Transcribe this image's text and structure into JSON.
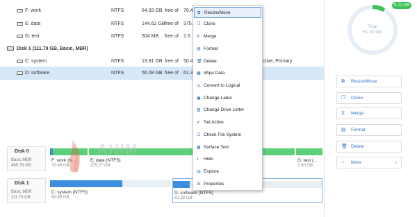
{
  "partitions_top": [
    {
      "name": "F: work",
      "fs": "NTFS",
      "capacity": "64.93 GB",
      "free_label": "free of",
      "free": "70.4"
    },
    {
      "name": "E: data",
      "fs": "NTFS",
      "capacity": "144.62 GB",
      "free_label": "free of",
      "free": "375.2"
    },
    {
      "name": "G: test",
      "fs": "NTFS",
      "capacity": "304 MB",
      "free_label": "free of",
      "free": "1.5"
    }
  ],
  "disk1_header": "Disk 1 (111.79 GB, Basic, MBR)",
  "partitions_disk1": [
    {
      "name": "C: system",
      "fs": "NTFS",
      "capacity": "19.81 GB",
      "free_label": "free of",
      "free": "50.4",
      "type": "ctive, Primary"
    },
    {
      "name": "D: software",
      "fs": "NTFS",
      "capacity": "56.08 GB",
      "free_label": "free of",
      "free": "61.3",
      "type": ""
    }
  ],
  "context_menu": [
    {
      "label": "Resize/Move",
      "icon": "resize-icon",
      "glyph": "⧉",
      "highlighted": true
    },
    {
      "label": "Clone",
      "icon": "clone-icon",
      "glyph": "❐"
    },
    {
      "label": "Merge",
      "icon": "merge-icon",
      "glyph": "⧖"
    },
    {
      "label": "Format",
      "icon": "format-icon",
      "glyph": "▤"
    },
    {
      "label": "Delete",
      "icon": "delete-icon",
      "glyph": "🗑"
    },
    {
      "label": "Wipe Data",
      "icon": "wipe-icon",
      "glyph": "▦"
    },
    {
      "label": "Convert to Logical",
      "icon": "convert-icon",
      "glyph": "◎"
    },
    {
      "label": "Change Label",
      "icon": "label-icon",
      "glyph": "▣"
    },
    {
      "label": "Change Drive Letter",
      "icon": "drive-letter-icon",
      "glyph": "▧"
    },
    {
      "label": "Set Active",
      "icon": "set-active-icon",
      "glyph": "✔"
    },
    {
      "label": "Check File System",
      "icon": "check-fs-icon",
      "glyph": "☑"
    },
    {
      "label": "Surface Test",
      "icon": "surface-test-icon",
      "glyph": "▩"
    },
    {
      "label": "Hide",
      "icon": "hide-icon",
      "glyph": "◐"
    },
    {
      "label": "Explore",
      "icon": "explore-icon",
      "glyph": "▥"
    },
    {
      "label": "Properties",
      "icon": "properties-icon",
      "glyph": "☰"
    }
  ],
  "right_panel": {
    "used_badge": "5.22 GB",
    "ring_line1": "Total",
    "ring_line2": "61.30 GB",
    "used_fraction": 0.085,
    "buttons": [
      {
        "label": "Resize/Move",
        "icon": "resize-icon",
        "glyph": "⧉"
      },
      {
        "label": "Clone",
        "icon": "clone-icon",
        "glyph": "❐"
      },
      {
        "label": "Merge",
        "icon": "merge-icon",
        "glyph": "⧖"
      },
      {
        "label": "Format",
        "icon": "format-icon",
        "glyph": "▤"
      },
      {
        "label": "Delete",
        "icon": "delete-icon",
        "glyph": "🗑"
      },
      {
        "label": "More",
        "icon": "more-icon",
        "glyph": "⋯",
        "chevron": "›"
      }
    ]
  },
  "disk_map": {
    "disk0": {
      "name": "Disk 0",
      "type": "Basic MBR",
      "size": "465.76 GB",
      "segments": [
        {
          "label": "F: work (N...",
          "size": "70.49 GB"
        },
        {
          "label": "E: data (NTFS)",
          "size": "375.27 GB"
        },
        {
          "label": "G: test (...",
          "size": "1.50 GB"
        }
      ]
    },
    "disk1": {
      "name": "Disk 1",
      "type": "Basic MBR",
      "size": "111.79 GB",
      "segments": [
        {
          "label": "C: system (NTFS)",
          "size": "50.49 GB"
        },
        {
          "label": "D: software (NTFS)",
          "size": "61.30 GB"
        }
      ]
    }
  },
  "colors": {
    "accent": "#2f72c4",
    "used_bar": "#3d8de0",
    "free_bar": "#5cd079",
    "selected_row": "#d6e7f8",
    "used_badge": "#3bc25a"
  },
  "watermark": {
    "text": "AHIM",
    "sub": "SOFT"
  }
}
